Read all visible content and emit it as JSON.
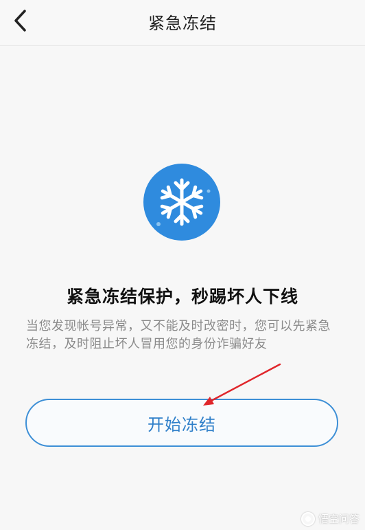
{
  "header": {
    "title": "紧急冻结",
    "back_icon": "chevron-left-icon"
  },
  "main": {
    "icon": "snowflake-icon",
    "icon_color": "#2f8bde",
    "headline": "紧急冻结保护，秒踢坏人下线",
    "description": "当您发现帐号异常，又不能及时改密时，您可以先紧急冻结，及时阻止坏人冒用您的身份诈骗好友",
    "start_button_label": "开始冻结"
  },
  "annotation": {
    "arrow_color": "#e0262b"
  },
  "watermark": {
    "text": "悟空问答"
  },
  "colors": {
    "accent": "#3d8fd6",
    "background": "#f7f7f7"
  }
}
